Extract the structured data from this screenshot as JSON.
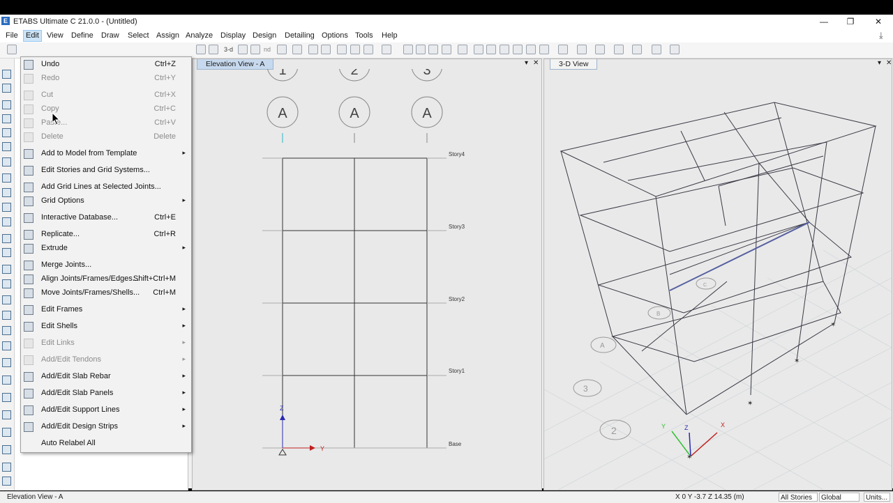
{
  "app": {
    "title": "ETABS Ultimate C 21.0.0 - (Untitled)",
    "logo_letter": "E",
    "window_controls": [
      "—",
      "❐",
      "✕"
    ]
  },
  "menubar": [
    "File",
    "Edit",
    "View",
    "Define",
    "Draw",
    "Select",
    "Assign",
    "Analyze",
    "Display",
    "Design",
    "Detailing",
    "Options",
    "Tools",
    "Help"
  ],
  "edit_menu": [
    {
      "label": "Undo",
      "shortcut": "Ctrl+Z",
      "disabled": false,
      "submenu": false,
      "icon": "undo-icon"
    },
    {
      "label": "Redo",
      "shortcut": "Ctrl+Y",
      "disabled": true,
      "submenu": false,
      "icon": "redo-icon"
    },
    {
      "label": "Cut",
      "shortcut": "Ctrl+X",
      "disabled": true,
      "submenu": false,
      "icon": "cut-icon"
    },
    {
      "label": "Copy",
      "shortcut": "Ctrl+C",
      "disabled": true,
      "submenu": false,
      "icon": "copy-icon"
    },
    {
      "label": "Paste...",
      "shortcut": "Ctrl+V",
      "disabled": true,
      "submenu": false,
      "icon": "paste-icon"
    },
    {
      "label": "Delete",
      "shortcut": "Delete",
      "disabled": true,
      "submenu": false,
      "icon": "delete-icon"
    },
    {
      "label": "Add to Model from Template",
      "shortcut": "",
      "disabled": false,
      "submenu": true,
      "icon": "template-icon"
    },
    {
      "label": "Edit Stories and Grid Systems...",
      "shortcut": "",
      "disabled": false,
      "submenu": false,
      "icon": "stories-icon"
    },
    {
      "label": "Add Grid Lines at Selected Joints...",
      "shortcut": "",
      "disabled": false,
      "submenu": false,
      "icon": "grid-lines-icon"
    },
    {
      "label": "Grid Options",
      "shortcut": "",
      "disabled": false,
      "submenu": true,
      "icon": "grid-options-icon"
    },
    {
      "label": "Interactive Database...",
      "shortcut": "Ctrl+E",
      "disabled": false,
      "submenu": false,
      "icon": "database-icon"
    },
    {
      "label": "Replicate...",
      "shortcut": "Ctrl+R",
      "disabled": false,
      "submenu": false,
      "icon": "replicate-icon"
    },
    {
      "label": "Extrude",
      "shortcut": "",
      "disabled": false,
      "submenu": true,
      "icon": "extrude-icon"
    },
    {
      "label": "Merge Joints...",
      "shortcut": "",
      "disabled": false,
      "submenu": false,
      "icon": "merge-icon"
    },
    {
      "label": "Align Joints/Frames/Edges...",
      "shortcut": "Shift+Ctrl+M",
      "disabled": false,
      "submenu": false,
      "icon": "align-icon"
    },
    {
      "label": "Move Joints/Frames/Shells...",
      "shortcut": "Ctrl+M",
      "disabled": false,
      "submenu": false,
      "icon": "move-icon"
    },
    {
      "label": "Edit Frames",
      "shortcut": "",
      "disabled": false,
      "submenu": true,
      "icon": "frame-icon"
    },
    {
      "label": "Edit Shells",
      "shortcut": "",
      "disabled": false,
      "submenu": true,
      "icon": "shell-icon"
    },
    {
      "label": "Edit Links",
      "shortcut": "",
      "disabled": true,
      "submenu": true,
      "icon": "link-icon"
    },
    {
      "label": "Add/Edit Tendons",
      "shortcut": "",
      "disabled": true,
      "submenu": true,
      "icon": "tendon-icon"
    },
    {
      "label": "Add/Edit Slab Rebar",
      "shortcut": "",
      "disabled": false,
      "submenu": true,
      "icon": "rebar-icon"
    },
    {
      "label": "Add/Edit Slab Panels",
      "shortcut": "",
      "disabled": false,
      "submenu": true,
      "icon": "panel-icon"
    },
    {
      "label": "Add/Edit Support Lines",
      "shortcut": "",
      "disabled": false,
      "submenu": true,
      "icon": "support-line-icon"
    },
    {
      "label": "Add/Edit Design Strips",
      "shortcut": "",
      "disabled": false,
      "submenu": true,
      "icon": "strip-icon"
    },
    {
      "label": "Auto Relabel All",
      "shortcut": "",
      "disabled": false,
      "submenu": false,
      "icon": ""
    }
  ],
  "elevation_view": {
    "tab": "Elevation View - A",
    "grid_bubbles_top": [
      "1",
      "2",
      "3"
    ],
    "grid_bubbles_row": [
      "A",
      "A",
      "A"
    ],
    "stories": [
      "Story4",
      "Story3",
      "Story2",
      "Story1",
      "Base"
    ],
    "axis_z": "Z",
    "axis_y": "Y"
  },
  "view_3d": {
    "tab": "3-D View",
    "grid_labels": [
      "A",
      "B",
      "C",
      "3",
      "2"
    ],
    "axis_labels": [
      "Y",
      "Z",
      "X"
    ]
  },
  "status": {
    "left": "Elevation View - A",
    "coords": "X 0  Y -3.7  Z 14.35 (m)",
    "stories_dropdown": "All Stories",
    "coord_dropdown": "Global",
    "units_button": "Units..."
  },
  "colors": {
    "accent": "#2a6cc0",
    "menu_highlight": "#cce4f7",
    "tab_active": "#c7d9ee",
    "structure_line": "#3a3a46",
    "axis_blue": "#2a2ab0",
    "axis_red": "#c02020",
    "axis_green": "#30c030"
  }
}
